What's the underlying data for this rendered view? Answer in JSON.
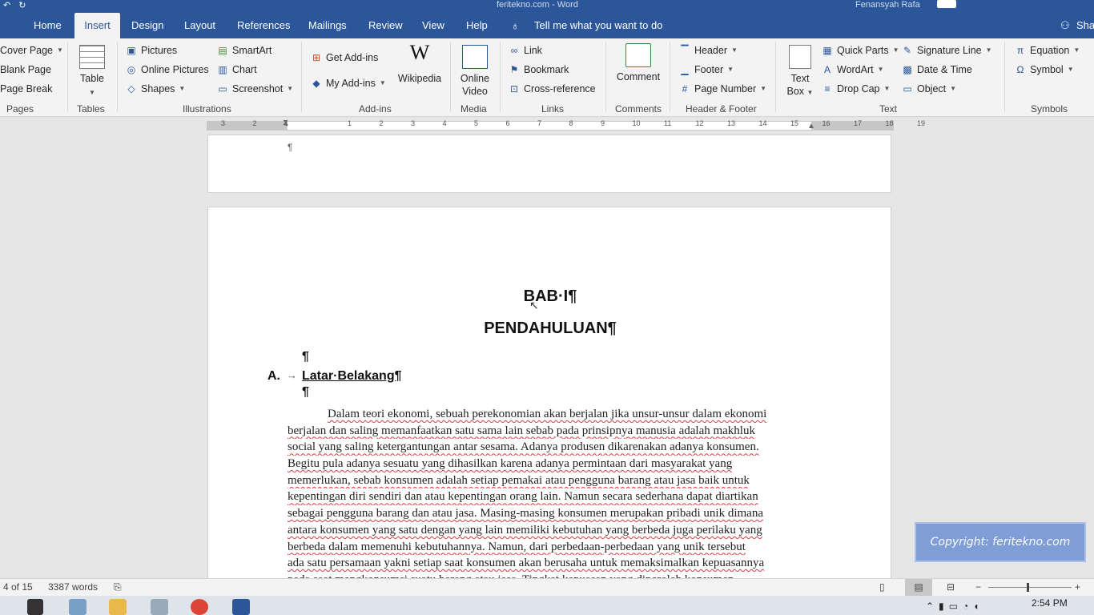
{
  "window": {
    "title": "feritekno.com - Word",
    "user": "Fenansyah Rafa"
  },
  "tabs": [
    "Home",
    "Insert",
    "Design",
    "Layout",
    "References",
    "Mailings",
    "Review",
    "View",
    "Help"
  ],
  "active_tab": "Insert",
  "tell_me": "Tell me what you want to do",
  "share_label": "Sha",
  "ribbon": {
    "pages": {
      "cover_page": "Cover Page",
      "blank_page": "Blank Page",
      "page_break": "Page Break",
      "group": "Pages"
    },
    "tables": {
      "table": "Table",
      "group": "Tables"
    },
    "illustrations": {
      "pictures": "Pictures",
      "online_pictures": "Online Pictures",
      "shapes": "Shapes",
      "smartart": "SmartArt",
      "chart": "Chart",
      "screenshot": "Screenshot",
      "group": "Illustrations"
    },
    "addins": {
      "get_addins": "Get Add-ins",
      "my_addins": "My Add-ins",
      "wikipedia": "Wikipedia",
      "group": "Add-ins"
    },
    "media": {
      "online_video_1": "Online",
      "online_video_2": "Video",
      "group": "Media"
    },
    "links": {
      "link": "Link",
      "bookmark": "Bookmark",
      "cross_reference": "Cross-reference",
      "group": "Links"
    },
    "comments": {
      "comment": "Comment",
      "group": "Comments"
    },
    "header_footer": {
      "header": "Header",
      "footer": "Footer",
      "page_number": "Page Number",
      "group": "Header & Footer"
    },
    "text": {
      "text_box_1": "Text",
      "text_box_2": "Box",
      "quick_parts": "Quick Parts",
      "wordart": "WordArt",
      "drop_cap": "Drop Cap",
      "signature_line": "Signature Line",
      "date_time": "Date & Time",
      "object": "Object",
      "group": "Text"
    },
    "symbols": {
      "equation": "Equation",
      "symbol": "Symbol",
      "group": "Symbols"
    }
  },
  "ruler": {
    "labels": [
      "3",
      "2",
      "1",
      "",
      "1",
      "2",
      "3",
      "4",
      "5",
      "6",
      "7",
      "8",
      "9",
      "10",
      "11",
      "12",
      "13",
      "14",
      "15",
      "16",
      "17",
      "18",
      "19"
    ]
  },
  "document": {
    "page1_mark": "¶",
    "chapter": "BAB·I¶",
    "title": "PENDAHULUAN¶",
    "empty_para": "¶",
    "section_letter": "A.",
    "tab_arrow": "→",
    "section_title": "Latar·Belakang¶",
    "paragraph_lines": [
      "Dalam teori ekonomi, sebuah perekonomian akan berjalan jika unsur-unsur dalam ekonomi",
      "berjalan dan saling memanfaatkan satu sama lain sebab pada prinsipnya manusia adalah makhluk",
      "social yang saling ketergantungan antar sesama. Adanya produsen dikarenakan adanya konsumen.",
      "Begitu pula adanya sesuatu yang dihasilkan karena adanya permintaan dari masyarakat yang",
      "memerlukan, sebab konsumen adalah setiap pemakai atau pengguna barang atau jasa baik untuk",
      "kepentingan diri sendiri dan atau kepentingan orang lain. Namun secara sederhana dapat diartikan",
      "sebagai pengguna barang dan atau jasa. Masing-masing konsumen merupakan pribadi unik dimana",
      "antara konsumen yang satu dengan yang lain memiliki kebutuhan yang berbeda juga perilaku yang",
      "berbeda dalam memenuhi kebutuhannya. Namun, dari perbedaan-perbedaan yang unik tersebut",
      "ada satu persamaan yakni setiap saat konsumen akan berusaha untuk memaksimalkan kepuasannya",
      "pada saat mengkonsumsi suatu barang atau jasa. Tingkat kepuasan yang diperoleh konsumen"
    ]
  },
  "watermark": "Copyright: feritekno.com",
  "status": {
    "page": "4 of 15",
    "words": "3387 words",
    "zoom_minus": "−",
    "zoom_plus": "+"
  },
  "taskbar": {
    "time": "2:54 PM"
  },
  "colors": {
    "accent": "#2b579a",
    "ribbon_bg": "#f3f3f3",
    "spell_underline": "#e0393e"
  }
}
